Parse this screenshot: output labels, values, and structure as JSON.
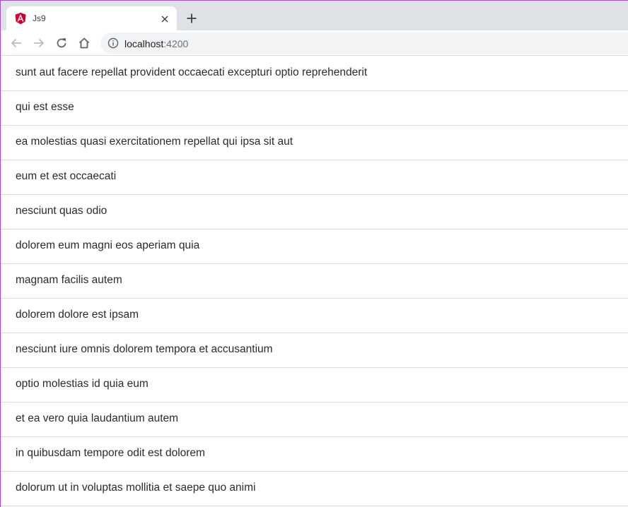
{
  "browser": {
    "tab": {
      "title": "Js9",
      "favicon": "angular-logo-icon",
      "close_icon": "close-icon"
    },
    "new_tab_icon": "plus-icon",
    "toolbar": {
      "back_icon": "back-arrow-icon",
      "forward_icon": "forward-arrow-icon",
      "reload_icon": "reload-icon",
      "home_icon": "home-icon",
      "site_info_icon": "info-icon",
      "url_host": "localhost",
      "url_port": ":4200"
    }
  },
  "posts": [
    {
      "title": "sunt aut facere repellat provident occaecati excepturi optio reprehenderit"
    },
    {
      "title": "qui est esse"
    },
    {
      "title": "ea molestias quasi exercitationem repellat qui ipsa sit aut"
    },
    {
      "title": "eum et est occaecati"
    },
    {
      "title": "nesciunt quas odio"
    },
    {
      "title": "dolorem eum magni eos aperiam quia"
    },
    {
      "title": "magnam facilis autem"
    },
    {
      "title": "dolorem dolore est ipsam"
    },
    {
      "title": "nesciunt iure omnis dolorem tempora et accusantium"
    },
    {
      "title": "optio molestias id quia eum"
    },
    {
      "title": "et ea vero quia laudantium autem"
    },
    {
      "title": "in quibusdam tempore odit est dolorem"
    },
    {
      "title": "dolorum ut in voluptas mollitia et saepe quo animi"
    }
  ]
}
